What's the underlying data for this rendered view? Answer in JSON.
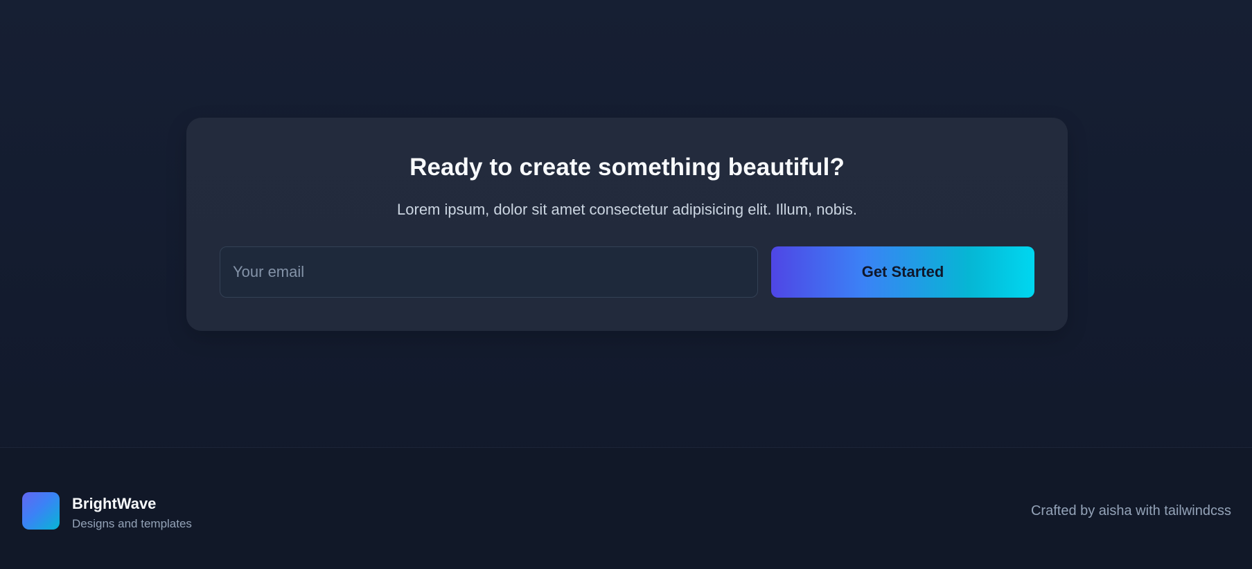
{
  "cta": {
    "title": "Ready to create something beautiful?",
    "subtitle": "Lorem ipsum, dolor sit amet consectetur adipisicing elit. Illum, nobis.",
    "email_placeholder": "Your email",
    "email_value": "",
    "button_label": "Get Started"
  },
  "footer": {
    "brand_name": "BrightWave",
    "brand_tagline": "Designs and templates",
    "credit": "Crafted by aisha with tailwindcss"
  },
  "colors": {
    "background": "#131b2e",
    "card": "#232b3d",
    "input_bg": "#1e293b",
    "accent_start": "#4f46e5",
    "accent_end": "#00d7f0"
  },
  "icons": {
    "brand_logo": "brand-logo-icon"
  }
}
